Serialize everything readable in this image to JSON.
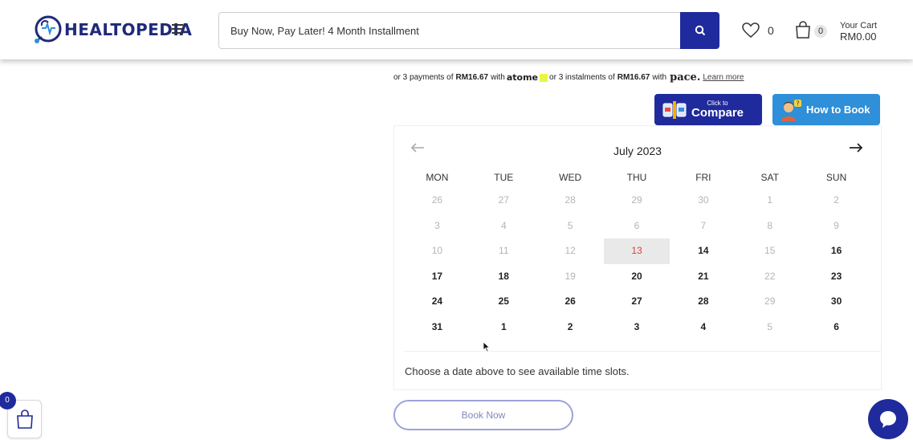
{
  "header": {
    "logo_text": "HEALTOPEDIA",
    "search_placeholder": "Buy Now, Pay Later! 4 Month Installment",
    "wishlist_count": "0",
    "cart_count": "0",
    "cart_label": "Your Cart",
    "cart_amount": "RM0.00"
  },
  "payment": {
    "prefix": "or 3 payments of",
    "amount1": "RM16.67",
    "with1": "with",
    "provider1": "atome",
    "mid": "or 3 instalments of",
    "amount2": "RM16.67",
    "with2": "with",
    "provider2": "pace.",
    "learn_more": "Learn more"
  },
  "buttons": {
    "compare_small": "Click to",
    "compare_big": "Compare",
    "how_to_book": "How to Book",
    "book_now": "Book Now"
  },
  "calendar": {
    "month": "July 2023",
    "weekdays": [
      "MON",
      "TUE",
      "WED",
      "THU",
      "FRI",
      "SAT",
      "SUN"
    ],
    "weeks": [
      [
        {
          "d": "26",
          "s": "muted"
        },
        {
          "d": "27",
          "s": "muted"
        },
        {
          "d": "28",
          "s": "muted"
        },
        {
          "d": "29",
          "s": "muted"
        },
        {
          "d": "30",
          "s": "muted"
        },
        {
          "d": "1",
          "s": "muted"
        },
        {
          "d": "2",
          "s": "muted"
        }
      ],
      [
        {
          "d": "3",
          "s": "muted"
        },
        {
          "d": "4",
          "s": "muted"
        },
        {
          "d": "5",
          "s": "muted"
        },
        {
          "d": "6",
          "s": "muted"
        },
        {
          "d": "7",
          "s": "muted"
        },
        {
          "d": "8",
          "s": "muted"
        },
        {
          "d": "9",
          "s": "muted"
        }
      ],
      [
        {
          "d": "10",
          "s": "muted"
        },
        {
          "d": "11",
          "s": "muted"
        },
        {
          "d": "12",
          "s": "muted"
        },
        {
          "d": "13",
          "s": "today"
        },
        {
          "d": "14",
          "s": "avail"
        },
        {
          "d": "15",
          "s": "muted"
        },
        {
          "d": "16",
          "s": "avail"
        }
      ],
      [
        {
          "d": "17",
          "s": "avail"
        },
        {
          "d": "18",
          "s": "avail"
        },
        {
          "d": "19",
          "s": "muted"
        },
        {
          "d": "20",
          "s": "avail"
        },
        {
          "d": "21",
          "s": "avail"
        },
        {
          "d": "22",
          "s": "muted"
        },
        {
          "d": "23",
          "s": "avail"
        }
      ],
      [
        {
          "d": "24",
          "s": "avail"
        },
        {
          "d": "25",
          "s": "avail"
        },
        {
          "d": "26",
          "s": "avail"
        },
        {
          "d": "27",
          "s": "avail"
        },
        {
          "d": "28",
          "s": "avail"
        },
        {
          "d": "29",
          "s": "muted"
        },
        {
          "d": "30",
          "s": "avail"
        }
      ],
      [
        {
          "d": "31",
          "s": "avail"
        },
        {
          "d": "1",
          "s": "avail"
        },
        {
          "d": "2",
          "s": "avail"
        },
        {
          "d": "3",
          "s": "avail"
        },
        {
          "d": "4",
          "s": "avail"
        },
        {
          "d": "5",
          "s": "muted"
        },
        {
          "d": "6",
          "s": "avail"
        }
      ]
    ],
    "hint": "Choose a date above to see available time slots."
  },
  "floating": {
    "bag_count": "0"
  },
  "colors": {
    "brand": "#1f2a9c",
    "accent_blue": "#2f8fd8",
    "today_red": "#e0403a"
  }
}
